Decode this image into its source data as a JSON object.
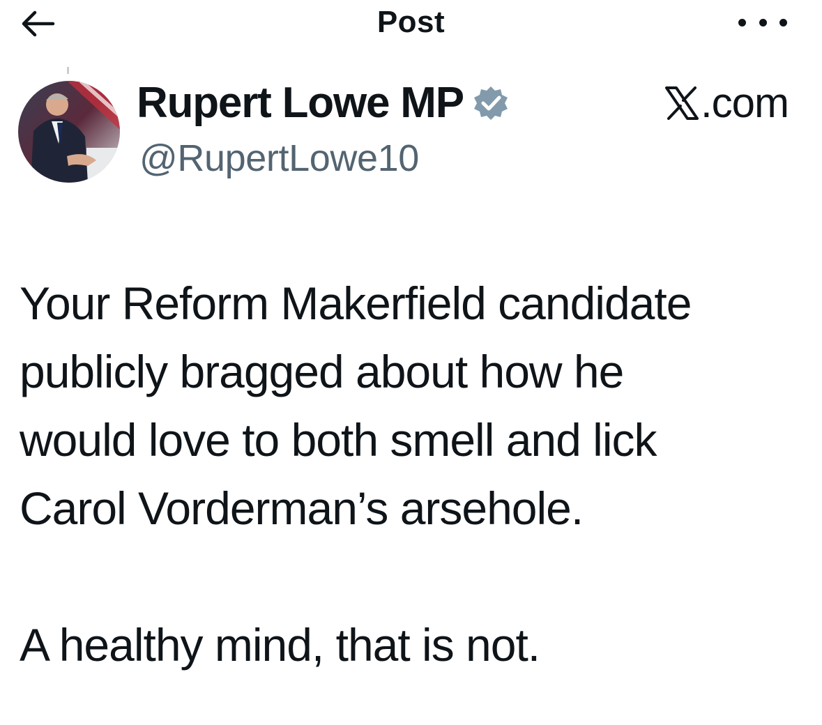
{
  "header": {
    "title": "Post",
    "back_icon": "arrow-left-icon",
    "more_icon": "more-horizontal-icon"
  },
  "author": {
    "display_name": "Rupert Lowe MP",
    "handle": "@RupertLowe10",
    "verified_icon": "verified-badge-icon",
    "verified_color": "#829aab",
    "avatar_icon": "avatar-photo"
  },
  "source": {
    "label": ".com",
    "logo_icon": "x-logo-icon"
  },
  "post": {
    "paragraphs": [
      "Your Reform Makerfield candidate\npublicly bragged about how he\nwould love to both smell and lick\nCarol Vorderman’s arsehole.",
      "A healthy mind, that is not."
    ]
  },
  "colors": {
    "text": "#0f1419",
    "secondary": "#536471",
    "background": "#ffffff"
  }
}
